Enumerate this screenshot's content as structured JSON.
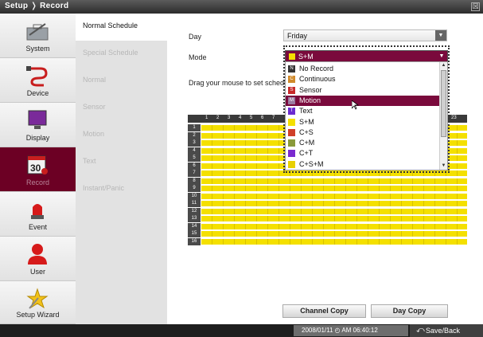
{
  "window": {
    "title": "Setup ❭ Record",
    "close": "☒"
  },
  "sidebar": {
    "items": [
      {
        "label": "System",
        "icon": "toolbox-icon"
      },
      {
        "label": "Device",
        "icon": "cable-icon"
      },
      {
        "label": "Display",
        "icon": "monitor-icon"
      },
      {
        "label": "Record",
        "icon": "calendar-icon",
        "active": true
      },
      {
        "label": "Event",
        "icon": "alarm-light-icon"
      },
      {
        "label": "User",
        "icon": "user-icon"
      },
      {
        "label": "Setup Wizard",
        "icon": "wizard-icon"
      }
    ]
  },
  "submenu": {
    "items": [
      "Normal Schedule",
      "Special Schedule",
      "Normal",
      "Sensor",
      "Motion",
      "Text",
      "Instant/Panic"
    ]
  },
  "main": {
    "day_label": "Day",
    "day_value": "Friday",
    "mode_label": "Mode",
    "mode_value": "S+M",
    "drag_hint": "Drag your mouse to set schedu",
    "hour_header": [
      "1",
      "2",
      "3",
      "4",
      "5",
      "6",
      "7"
    ],
    "hour_last": "23",
    "rows": [
      "1",
      "2",
      "3",
      "4",
      "5",
      "6",
      "7",
      "8",
      "9",
      "10",
      "11",
      "12",
      "13",
      "14",
      "15",
      "16"
    ],
    "channel_copy": "Channel Copy",
    "day_copy": "Day Copy"
  },
  "dropdown": {
    "options": [
      {
        "label": "No Record",
        "mark": "N",
        "color": "#333333"
      },
      {
        "label": "Continuous",
        "mark": "C",
        "color": "#d08a2a"
      },
      {
        "label": "Sensor",
        "mark": "S",
        "color": "#c82a2a"
      },
      {
        "label": "Motion",
        "mark": "M",
        "color": "#9b7aa0"
      },
      {
        "label": "Text",
        "mark": "T",
        "color": "#6a2ad0"
      },
      {
        "label": "S+M",
        "mark": "",
        "color": "#f4e000"
      },
      {
        "label": "C+S",
        "mark": "",
        "color": "#d0402a"
      },
      {
        "label": "C+M",
        "mark": "",
        "color": "#8a9a3a"
      },
      {
        "label": "C+T",
        "mark": "",
        "color": "#7a2ad0"
      },
      {
        "label": "C+S+M",
        "mark": "",
        "color": "#e8d000"
      }
    ],
    "selected": "Motion"
  },
  "status": {
    "datetime": "2008/01/11 ◴ AM 06:40:12",
    "save_back": "Save/Back",
    "save_icon": "back-arrow-icon"
  },
  "colors": {
    "accent": "#7a0a3c",
    "record_fill": "#f4e000"
  }
}
